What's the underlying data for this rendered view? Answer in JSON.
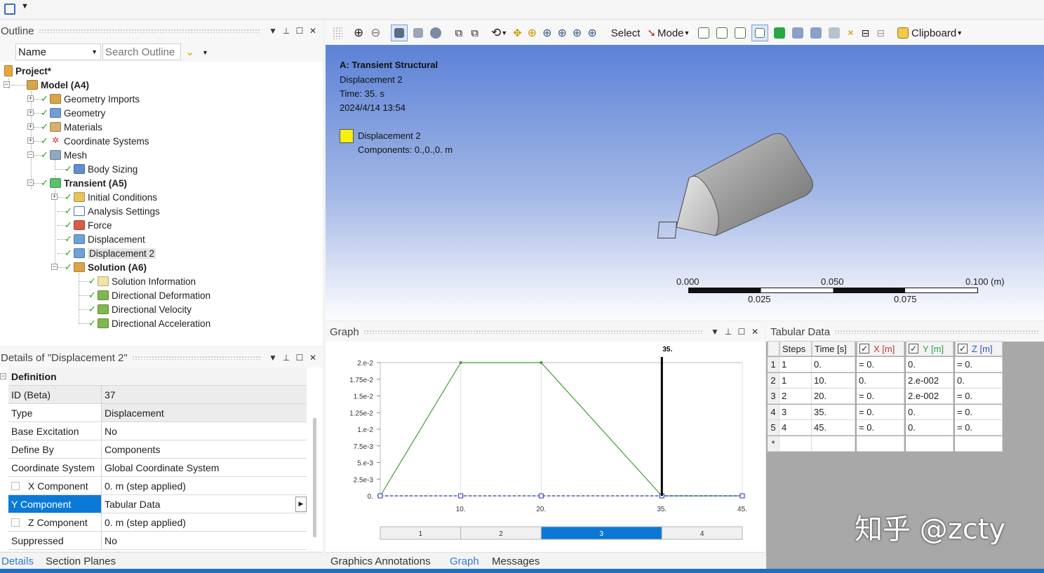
{
  "toolbar": {
    "select_label": "Select",
    "mode_label": "Mode",
    "clipboard_label": "Clipboard"
  },
  "outline": {
    "title": "Outline",
    "name_filter": "Name",
    "search_placeholder": "Search Outline",
    "tree": [
      {
        "label": "Project*",
        "bold": true
      },
      {
        "label": "Model (A4)",
        "bold": true
      },
      {
        "label": "Geometry Imports"
      },
      {
        "label": "Geometry"
      },
      {
        "label": "Materials"
      },
      {
        "label": "Coordinate Systems"
      },
      {
        "label": "Mesh"
      },
      {
        "label": "Body Sizing"
      },
      {
        "label": "Transient (A5)",
        "bold": true
      },
      {
        "label": "Initial Conditions"
      },
      {
        "label": "Analysis Settings"
      },
      {
        "label": "Force"
      },
      {
        "label": "Displacement"
      },
      {
        "label": "Displacement 2",
        "selected": true
      },
      {
        "label": "Solution (A6)",
        "bold": true
      },
      {
        "label": "Solution Information"
      },
      {
        "label": "Directional Deformation"
      },
      {
        "label": "Directional Velocity"
      },
      {
        "label": "Directional Acceleration"
      }
    ]
  },
  "details": {
    "title": "Details of \"Displacement 2\"",
    "section": "Definition",
    "rows": [
      {
        "key": "ID (Beta)",
        "value": "37"
      },
      {
        "key": "Type",
        "value": "Displacement"
      },
      {
        "key": "Base Excitation",
        "value": "No"
      },
      {
        "key": "Define By",
        "value": "Components"
      },
      {
        "key": "Coordinate System",
        "value": "Global Coordinate System"
      },
      {
        "key": "X Component",
        "value": "0. m  (step applied)"
      },
      {
        "key": "Y Component",
        "value": "Tabular Data"
      },
      {
        "key": "Z Component",
        "value": "0. m  (step applied)"
      },
      {
        "key": "Suppressed",
        "value": "No"
      }
    ],
    "tabs": [
      "Details",
      "Section Planes"
    ]
  },
  "viewport": {
    "title": "A: Transient Structural",
    "subtitle": "Displacement 2",
    "time": "Time: 35. s",
    "date": "2024/4/14 13:54",
    "legend_label": "Displacement 2",
    "legend_components": "Components: 0.,0.,0. m",
    "legend_color": "#f5f010",
    "scale_top": [
      "0.000",
      "0.050",
      "0.100 (m)"
    ],
    "scale_bottom": [
      "0.025",
      "0.075"
    ]
  },
  "graph": {
    "title": "Graph",
    "current_time_label": "35.",
    "step_labels": [
      "1",
      "2",
      "3",
      "4"
    ],
    "active_step": "3",
    "bottom_tabs": [
      "Graphics Annotations",
      "Graph",
      "Messages"
    ]
  },
  "chart_data": {
    "type": "line",
    "x": [
      0,
      10,
      20,
      35,
      45
    ],
    "series": [
      {
        "values": [
          0,
          0.02,
          0.02,
          0,
          0
        ],
        "color": "#3f9c35"
      },
      {
        "values": [
          0,
          0,
          0,
          0,
          0
        ],
        "color": "#2030c0",
        "style": "dashed"
      }
    ],
    "xticks": [
      "10.",
      "20.",
      "35.",
      "45."
    ],
    "yticks": [
      "0.",
      "2.5e-3",
      "5.e-3",
      "7.5e-3",
      "1.e-2",
      "1.25e-2",
      "1.5e-2",
      "1.75e-2",
      "2.e-2"
    ],
    "ylim": [
      0,
      0.02
    ],
    "xlim": [
      0,
      45
    ],
    "current_time": 35
  },
  "tabular": {
    "title": "Tabular Data",
    "headers": [
      "Steps",
      "Time [s]",
      "X [m]",
      "Y [m]",
      "Z [m]"
    ],
    "rows": [
      [
        "1",
        "1",
        "0.",
        "= 0.",
        "0.",
        "= 0."
      ],
      [
        "2",
        "1",
        "10.",
        "0.",
        "2.e-002",
        "0."
      ],
      [
        "3",
        "2",
        "20.",
        "= 0.",
        "2.e-002",
        "= 0."
      ],
      [
        "4",
        "3",
        "35.",
        "= 0.",
        "0.",
        "= 0."
      ],
      [
        "5",
        "4",
        "45.",
        "= 0.",
        "0.",
        "= 0."
      ]
    ],
    "new_row_marker": "*"
  },
  "watermark": "知乎 @zcty"
}
